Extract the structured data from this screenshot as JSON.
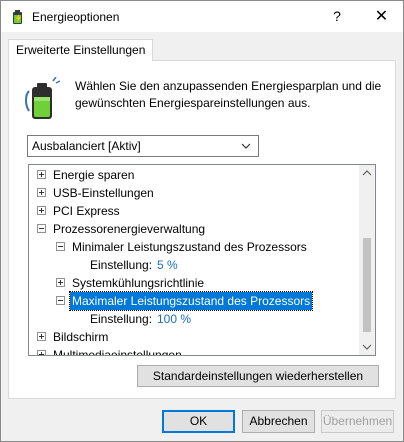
{
  "window": {
    "title": "Energieoptionen",
    "help_glyph": "?",
    "close_glyph": "✕"
  },
  "tab": {
    "label": "Erweiterte Einstellungen"
  },
  "intro": {
    "text": "Wählen Sie den anzupassenden Energiesparplan und die gewünschten Energiespareinstellungen aus."
  },
  "plan_select": {
    "value": "Ausbalanciert [Aktiv]"
  },
  "tree": {
    "items": [
      {
        "label": "Energie sparen",
        "expander": "plus"
      },
      {
        "label": "USB-Einstellungen",
        "expander": "plus"
      },
      {
        "label": "PCI Express",
        "expander": "plus"
      },
      {
        "label": "Prozessorenergieverwaltung",
        "expander": "minus"
      },
      {
        "label": "Minimaler Leistungszustand des Prozessors",
        "expander": "minus"
      },
      {
        "label": "Einstellung:",
        "value": "5 %"
      },
      {
        "label": "Systemkühlungsrichtlinie",
        "expander": "plus"
      },
      {
        "label": "Maximaler Leistungszustand des Prozessors",
        "expander": "minus",
        "selected": true
      },
      {
        "label": "Einstellung:",
        "value": "100 %"
      },
      {
        "label": "Bildschirm",
        "expander": "plus"
      },
      {
        "label": "Multimediaeinstellungen",
        "expander": "plus"
      }
    ]
  },
  "restore_button": {
    "label": "Standardeinstellungen wiederherstellen"
  },
  "buttons": {
    "ok": "OK",
    "cancel": "Abbrechen",
    "apply": "Übernehmen"
  },
  "colors": {
    "selection": "#0078d7",
    "value_text": "#1a6fc4",
    "battery_green": "#4caf50"
  }
}
